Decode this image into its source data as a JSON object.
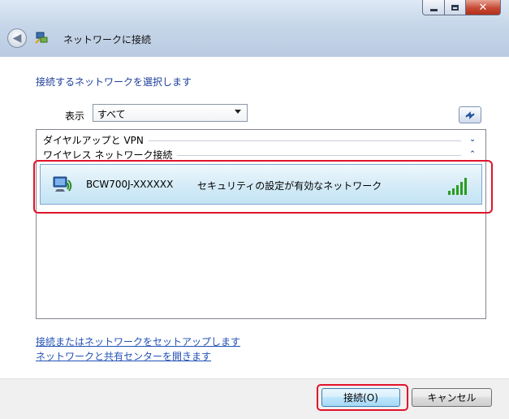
{
  "window": {
    "title": "ネットワークに接続",
    "controls": [
      "minimize",
      "maximize",
      "close"
    ],
    "back_icon": "back-arrow-icon"
  },
  "main": {
    "heading": "接続するネットワークを選択します",
    "show_label": "表示",
    "show_value": "すべて",
    "refresh_icon": "refresh-icon",
    "groups": [
      {
        "label": "ダイヤルアップと VPN",
        "state": "collapsed"
      },
      {
        "label": "ワイヤレス ネットワーク接続",
        "state": "expanded"
      }
    ],
    "networks": [
      {
        "ssid": "BCW700J-XXXXXX",
        "security": "セキュリティの設定が有効なネットワーク",
        "signal_bars": 5,
        "selected": true
      }
    ],
    "links": [
      "接続またはネットワークをセットアップします",
      "ネットワークと共有センターを開きます"
    ]
  },
  "buttons": {
    "connect": "接続(O)",
    "cancel": "キャンセル"
  },
  "colors": {
    "heading": "#1d3e9a",
    "link": "#2351b5",
    "highlight": "#e0142b",
    "selected_row": "#d4ebf7"
  }
}
